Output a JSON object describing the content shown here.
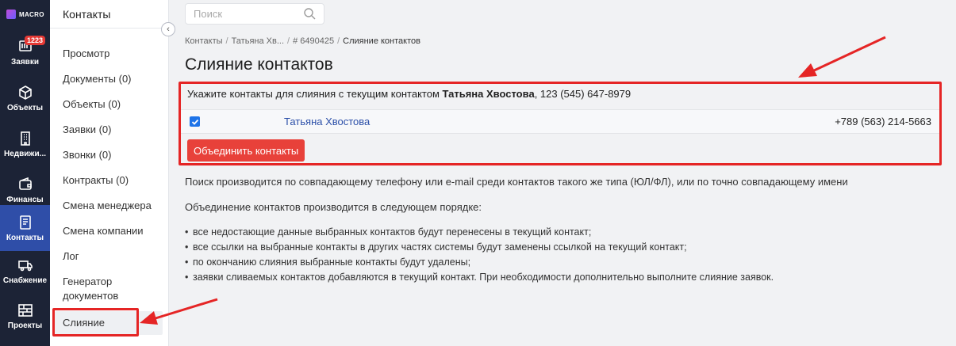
{
  "logo": {
    "text": "MACRO"
  },
  "rail": {
    "items": [
      {
        "label": "Заявки",
        "icon": "requests-icon",
        "badge": "1223"
      },
      {
        "label": "Объекты",
        "icon": "cube-icon"
      },
      {
        "label": "Недвижи...",
        "icon": "building-icon"
      },
      {
        "label": "Финансы",
        "icon": "wallet-icon"
      },
      {
        "label": "Контакты",
        "icon": "contacts-icon",
        "active": true
      },
      {
        "label": "Снабжение",
        "icon": "truck-icon"
      },
      {
        "label": "Проекты",
        "icon": "brick-icon"
      }
    ]
  },
  "submenu": {
    "title": "Контакты",
    "items": [
      "Просмотр",
      "Документы (0)",
      "Объекты (0)",
      "Заявки (0)",
      "Звонки (0)",
      "Контракты (0)",
      "Смена менеджера",
      "Смена компании",
      "Лог",
      "Генератор",
      "документов",
      "Слияние"
    ],
    "selected": "Слияние"
  },
  "search": {
    "placeholder": "Поиск"
  },
  "breadcrumb": [
    "Контакты",
    "Татьяна Хв...",
    "# 6490425",
    "Слияние контактов"
  ],
  "page_title": "Слияние контактов",
  "merge": {
    "instruction_prefix": "Укажите контакты для слияния с текущим контактом ",
    "current_contact": "Татьяна Хвостова",
    "current_phone": ", 123 (545) 647-8979",
    "row": {
      "checked": true,
      "name": "Татьяна Хвостова",
      "phone": "+789 (563) 214-5663"
    },
    "button_label": "Объединить контакты"
  },
  "description": {
    "search_note": "Поиск производится по совпадающему телефону или e-mail среди контактов такого же типа (ЮЛ/ФЛ), или по точно совпадающему имени",
    "order_title": "Объединение контактов производится в следующем порядке:",
    "rules": [
      "все недостающие данные выбранных контактов будут перенесены в текущий контакт;",
      "все ссылки на выбранные контакты в других частях системы будут заменены ссылкой на текущий контакт;",
      "по окончанию слияния выбранные контакты будут удалены;",
      "заявки сливаемых контактов добавляются в текущий контакт. При необходимости дополнительно выполните слияние заявок."
    ]
  },
  "colors": {
    "rail_bg": "#1c2336",
    "rail_active": "#2f4ea8",
    "accent_red": "#e8413a",
    "annotation": "#e52525",
    "link": "#2b4fa8"
  }
}
